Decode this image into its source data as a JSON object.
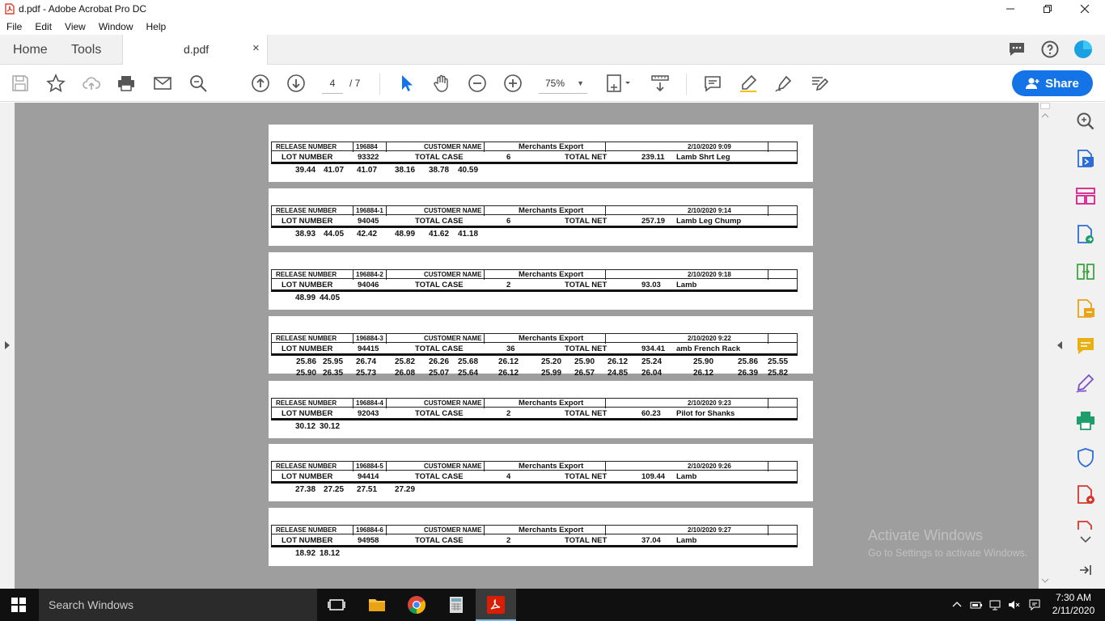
{
  "window": {
    "title": "d.pdf - Adobe Acrobat Pro DC"
  },
  "menu": [
    "File",
    "Edit",
    "View",
    "Window",
    "Help"
  ],
  "tabs": {
    "home": "Home",
    "tools": "Tools",
    "document": "d.pdf",
    "close_glyph": "×"
  },
  "toolbar": {
    "page_current": "4",
    "page_total": "/ 7",
    "zoom": "75%",
    "share_label": "Share"
  },
  "document": {
    "records": [
      {
        "release_label": "RELEASE NUMBER",
        "release_number": "196884",
        "customer_label": "CUSTOMER NAME",
        "customer_name": "Merchants Export",
        "datetime": "2/10/2020 9:09",
        "lot_label": "LOT NUMBER",
        "lot_number": "93322",
        "case_label": "TOTAL CASE",
        "total_case": "6",
        "net_label": "TOTAL NET",
        "total_net": "239.11",
        "product": "Lamb Shrt Leg",
        "weights": [
          [
            "39.44",
            "41.07",
            "41.07",
            "38.16",
            "38.78",
            "40.59"
          ]
        ]
      },
      {
        "release_label": "RELEASE NUMBER",
        "release_number": "196884-1",
        "customer_label": "CUSTOMER NAME",
        "customer_name": "Merchants Export",
        "datetime": "2/10/2020 9:14",
        "lot_label": "LOT NUMBER",
        "lot_number": "94045",
        "case_label": "TOTAL CASE",
        "total_case": "6",
        "net_label": "TOTAL NET",
        "total_net": "257.19",
        "product": "Lamb Leg Chump",
        "weights": [
          [
            "38.93",
            "44.05",
            "42.42",
            "48.99",
            "41.62",
            "41.18"
          ]
        ]
      },
      {
        "release_label": "RELEASE NUMBER",
        "release_number": "196884-2",
        "customer_label": "CUSTOMER NAME",
        "customer_name": "Merchants Export",
        "datetime": "2/10/2020 9:18",
        "lot_label": "LOT NUMBER",
        "lot_number": "94046",
        "case_label": "TOTAL CASE",
        "total_case": "2",
        "net_label": "TOTAL NET",
        "total_net": "93.03",
        "product": "Lamb",
        "weights": [
          [
            "48.99",
            "44.05"
          ]
        ]
      },
      {
        "release_label": "RELEASE NUMBER",
        "release_number": "196884-3",
        "customer_label": "CUSTOMER NAME",
        "customer_name": "Merchants Export",
        "datetime": "2/10/2020 9:22",
        "lot_label": "LOT NUMBER",
        "lot_number": "94415",
        "case_label": "TOTAL CASE",
        "total_case": "36",
        "net_label": "TOTAL NET",
        "total_net": "934.41",
        "product": "amb French Rack",
        "weights": [
          [
            "25.86",
            "25.95",
            "26.74",
            "25.82",
            "26.26",
            "25.68",
            "26.12",
            "25.20",
            "25.90",
            "26.12",
            "25.24",
            "25.90",
            "25.86",
            "25.55"
          ],
          [
            "25.90",
            "26.35",
            "25.73",
            "26.08",
            "25.07",
            "25.64",
            "26.12",
            "25.99",
            "26.57",
            "24.85",
            "26.04",
            "26.12",
            "26.39",
            "25.82"
          ]
        ]
      },
      {
        "release_label": "RELEASE NUMBER",
        "release_number": "196884-4",
        "customer_label": "CUSTOMER NAME",
        "customer_name": "Merchants Export",
        "datetime": "2/10/2020 9:23",
        "lot_label": "LOT NUMBER",
        "lot_number": "92043",
        "case_label": "TOTAL CASE",
        "total_case": "2",
        "net_label": "TOTAL NET",
        "total_net": "60.23",
        "product": "Pilot for Shanks",
        "weights": [
          [
            "30.12",
            "30.12"
          ]
        ]
      },
      {
        "release_label": "RELEASE NUMBER",
        "release_number": "196884-5",
        "customer_label": "CUSTOMER NAME",
        "customer_name": "Merchants Export",
        "datetime": "2/10/2020 9:26",
        "lot_label": "LOT NUMBER",
        "lot_number": "94414",
        "case_label": "TOTAL CASE",
        "total_case": "4",
        "net_label": "TOTAL NET",
        "total_net": "109.44",
        "product": "Lamb",
        "weights": [
          [
            "27.38",
            "27.25",
            "27.51",
            "27.29"
          ]
        ]
      },
      {
        "release_label": "RELEASE NUMBER",
        "release_number": "196884-6",
        "customer_label": "CUSTOMER NAME",
        "customer_name": "Merchants Export",
        "datetime": "2/10/2020 9:27",
        "lot_label": "LOT NUMBER",
        "lot_number": "94958",
        "case_label": "TOTAL CASE",
        "total_case": "2",
        "net_label": "TOTAL NET",
        "total_net": "37.04",
        "product": "Lamb",
        "weights": [
          [
            "18.92",
            "18.12"
          ]
        ]
      }
    ]
  },
  "watermark": {
    "line1": "Activate Windows",
    "line2": "Go to Settings to activate Windows."
  },
  "taskbar": {
    "search_placeholder": "Search Windows",
    "time": "7:30 AM",
    "date": "2/11/2020"
  },
  "colors": {
    "accent": "#1473e6",
    "doc_background": "#9e9e9e",
    "taskbar": "#101010",
    "pdf_red": "#d81e05"
  }
}
